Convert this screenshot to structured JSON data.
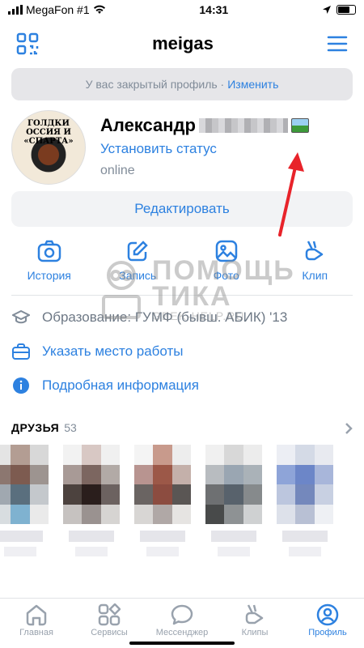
{
  "status_bar": {
    "carrier": "MegaFon #1",
    "time": "14:31"
  },
  "header": {
    "title": "meigas"
  },
  "private_banner": {
    "text": "У вас закрытый профиль ·",
    "link": "Изменить"
  },
  "profile": {
    "name": "Александр",
    "status_link": "Установить статус",
    "presence": "online",
    "avatar_text": "ГОЛДКИ ОССИЯ И «СПАРТА»"
  },
  "edit_button": "Редактировать",
  "actions": [
    {
      "label": "История",
      "icon": "camera-icon"
    },
    {
      "label": "Запись",
      "icon": "pencil-square-icon"
    },
    {
      "label": "Фото",
      "icon": "photo-icon"
    },
    {
      "label": "Клип",
      "icon": "clip-icon"
    }
  ],
  "watermark": {
    "big1": "ПОМОЩЬ",
    "big2": "ТИКА",
    "site": "GEEK-HELP.RU"
  },
  "info": {
    "education": "Образование: ГУМФ (бывш. АБИК) '13",
    "work": "Указать место работы",
    "details": "Подробная информация"
  },
  "friends": {
    "title": "ДРУЗЬЯ",
    "count": "53"
  },
  "tabbar": [
    {
      "label": "Главная",
      "icon": "home-icon"
    },
    {
      "label": "Сервисы",
      "icon": "services-icon"
    },
    {
      "label": "Мессенджер",
      "icon": "chat-bubble-icon"
    },
    {
      "label": "Клипы",
      "icon": "clips-icon"
    },
    {
      "label": "Профиль",
      "icon": "profile-icon",
      "active": true
    }
  ],
  "colors": {
    "accent": "#2d81e0",
    "muted": "#818c99",
    "arrow": "#e8232a"
  }
}
